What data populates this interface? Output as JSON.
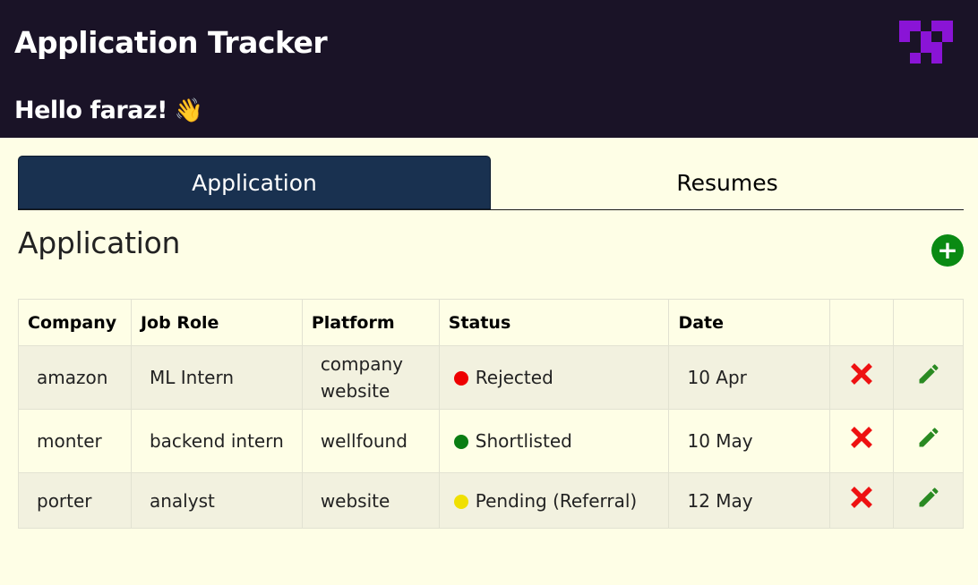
{
  "header": {
    "title": "Application Tracker",
    "greeting": "Hello faraz!",
    "greeting_emoji": "👋",
    "logo_color": "#8a14d6",
    "background": "#1a1327"
  },
  "tabs": [
    {
      "label": "Application",
      "active": true
    },
    {
      "label": "Resumes",
      "active": false
    }
  ],
  "section": {
    "title": "Application",
    "add_label": "+",
    "add_color": "#0a8a13"
  },
  "table": {
    "columns": [
      "Company",
      "Job Role",
      "Platform",
      "Status",
      "Date",
      "",
      ""
    ],
    "rows": [
      {
        "company": "amazon",
        "role": "ML Intern",
        "platform": "company website",
        "status": "Rejected",
        "status_color": "#ee0000",
        "date": "10 Apr"
      },
      {
        "company": "monter",
        "role": "backend intern",
        "platform": "wellfound",
        "status": "Shortlisted",
        "status_color": "#0a7d12",
        "date": "10 May"
      },
      {
        "company": "porter",
        "role": "analyst",
        "platform": "website",
        "status": "Pending (Referral)",
        "status_color": "#f0e000",
        "date": "12 May"
      }
    ],
    "delete_icon": "close-icon",
    "edit_icon": "pencil-icon",
    "delete_color": "#ee1111",
    "edit_color": "#2a8a22"
  }
}
